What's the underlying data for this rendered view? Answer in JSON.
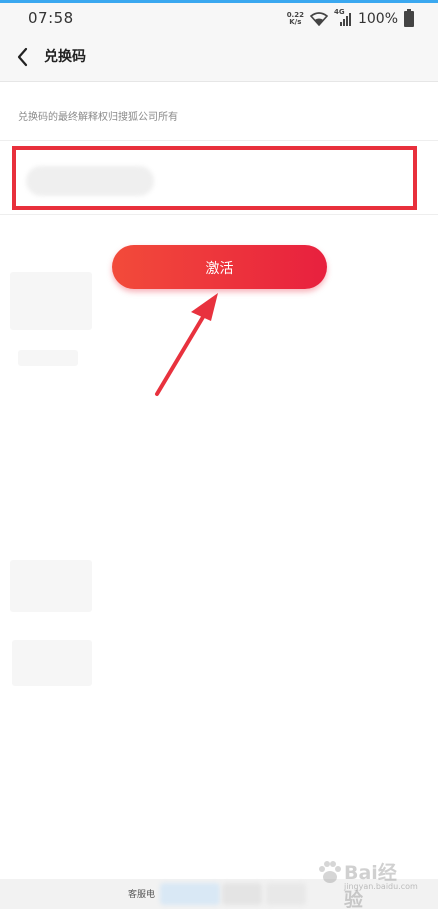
{
  "status_bar": {
    "time": "07:58",
    "speed_value": "0.22",
    "speed_unit": "K/s",
    "network": "4G",
    "battery": "100%"
  },
  "header": {
    "back_icon": "chevron-left-icon",
    "title": "兑换码"
  },
  "main": {
    "notice": "兑换码的最终解释权归搜狐公司所有",
    "code_input": {
      "value": "",
      "placeholder": ""
    },
    "activate_label": "激活"
  },
  "bottom_bar": {
    "service_label": "客服电"
  },
  "watermark": {
    "brand": "Bai",
    "brand_suffix": "经验",
    "domain": "jingyan.baidu.com"
  },
  "colors": {
    "accent": "#e8203e",
    "highlight_frame": "#e8303c",
    "top_line": "#3aa8f0"
  }
}
